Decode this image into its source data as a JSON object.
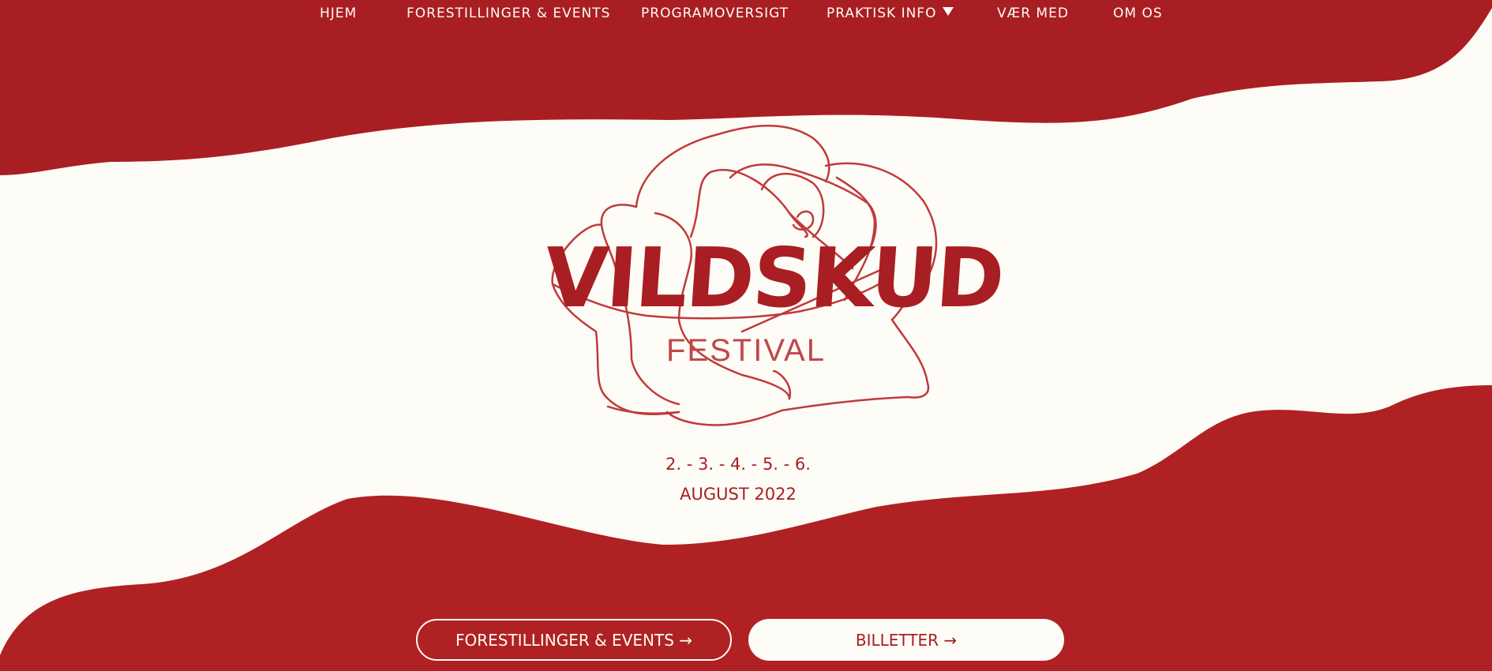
{
  "nav": {
    "items": [
      {
        "label": "HJEM"
      },
      {
        "label": "FORESTILLINGER & EVENTS"
      },
      {
        "label": "PROGRAMOVERSIGT"
      },
      {
        "label": "PRAKTISK INFO",
        "dropdown": true
      },
      {
        "label": "VÆR MED"
      },
      {
        "label": "OM OS"
      }
    ]
  },
  "hero": {
    "title": "VILDSKUD",
    "subtitle": "FESTIVAL",
    "dates_line1": "2. - 3. - 4. - 5. - 6.",
    "dates_line2": "AUGUST 2022"
  },
  "buttons": {
    "events_label": "FORESTILLINGER & EVENTS →",
    "tickets_label": "BILLETTER →"
  },
  "colors": {
    "primary_red": "#a91e22",
    "bottom_red": "#b02124",
    "cream": "#fdfcf6",
    "rose_outline": "#c0393c"
  },
  "icons": {
    "dropdown": "caret-down-icon",
    "logo_graphic": "rose-outline-icon"
  }
}
